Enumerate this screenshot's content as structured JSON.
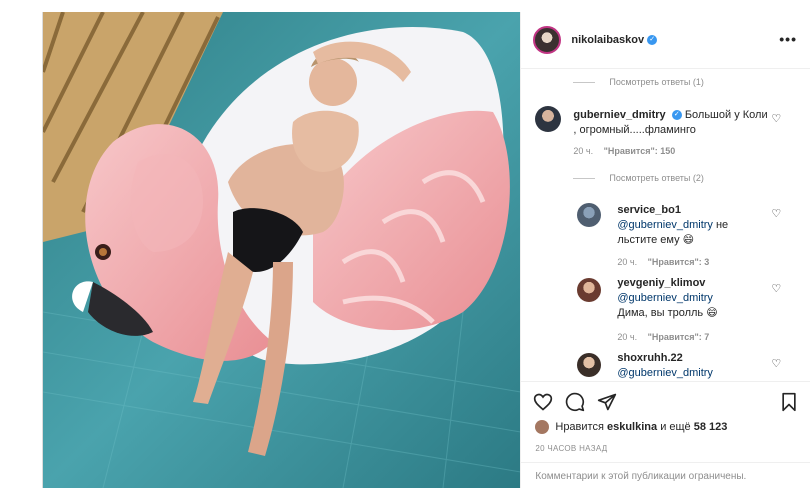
{
  "header": {
    "username": "nikolaibaskov",
    "more_label": "•••"
  },
  "comments": {
    "top_view_replies": "Посмотреть ответы (1)",
    "main": {
      "username": "guberniev_dmitry",
      "text": "Большой у Коли , огромный.....фламинго",
      "time": "20 ч.",
      "likes": "\"Нравится\": 150",
      "view_replies": "Посмотреть ответы (2)"
    },
    "replies": [
      {
        "username": "service_bo1",
        "mention": "@guberniev_dmitry",
        "text": "не льстите ему 😄",
        "time": "20 ч.",
        "likes": "\"Нравится\": 3"
      },
      {
        "username": "yevgeniy_klimov",
        "mention": "@guberniev_dmitry",
        "text": "Дима, вы тролль 😄",
        "time": "20 ч.",
        "likes": "\"Нравится\": 7"
      },
      {
        "username": "shoxruhh.22",
        "mention": "@guberniev_dmitry",
        "text": "",
        "time": "",
        "likes": ""
      }
    ]
  },
  "actions": {
    "likes_prefix": "Нравится",
    "likes_user": "eskulkina",
    "likes_mid": "и ещё",
    "likes_count": "58 123",
    "posted_ago": "20 ЧАСОВ НАЗАД",
    "comments_limited": "Комментарии к этой публикации ограничены."
  },
  "icons": {
    "like": "heart-outline-icon",
    "comment": "comment-bubble-icon",
    "share": "paper-plane-icon",
    "save": "bookmark-icon",
    "more": "ellipsis-icon",
    "verified": "verified-badge-icon"
  },
  "colors": {
    "verified_blue": "#3897f0",
    "mention": "#00376b",
    "secondary_text": "#8e8e8e",
    "border": "#dbdbdb"
  }
}
